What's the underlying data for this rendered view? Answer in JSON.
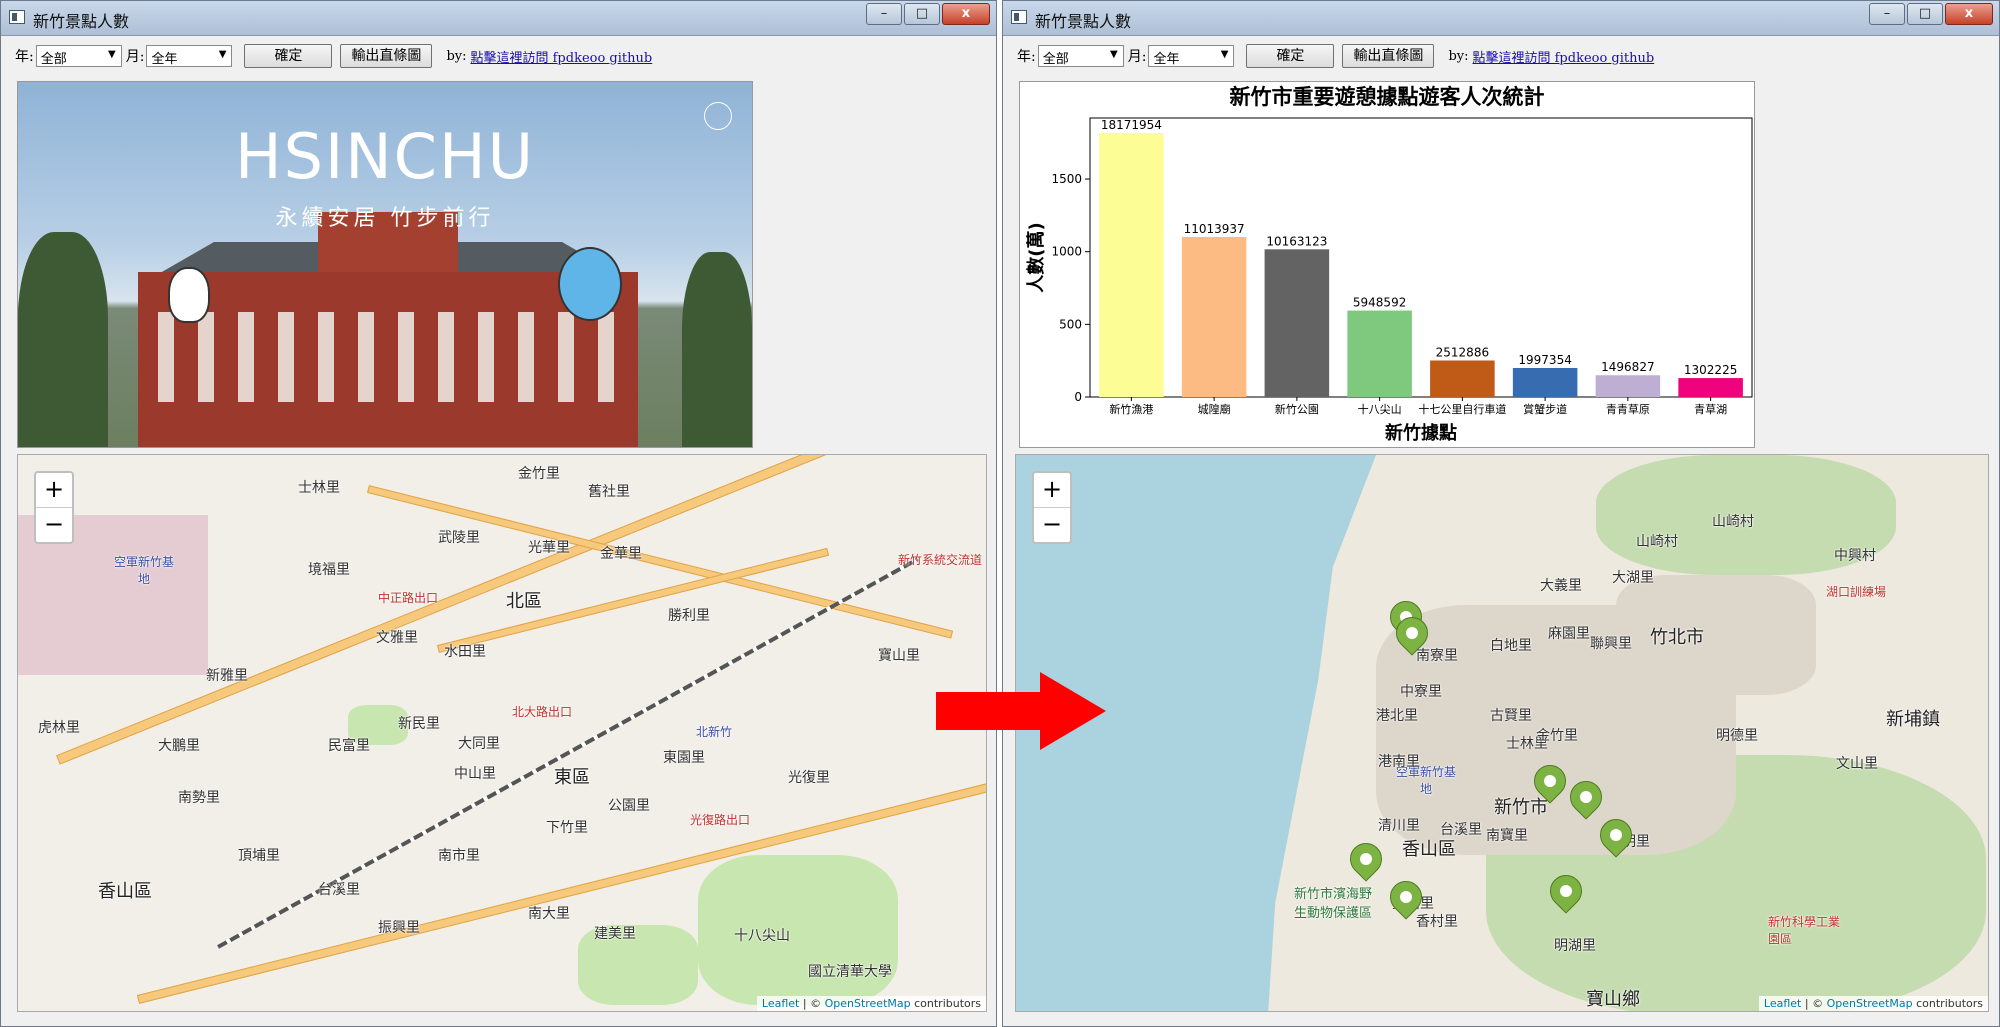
{
  "left": {
    "title": "新竹景點人數",
    "window_buttons": {
      "minimize": "–",
      "maximize": "□",
      "close": "x"
    },
    "toolbar": {
      "year_label": "年:",
      "year_value": "全部",
      "month_label": "月:",
      "month_value": "全年",
      "confirm": "確定",
      "export": "輸出直條圖",
      "by_label": "by:",
      "link_text": "點擊這裡訪問 fpdkeoo github"
    },
    "banner": {
      "title": "HSINCHU",
      "subtitle": "永續安居 竹步前行"
    },
    "map": {
      "zoom_in": "+",
      "zoom_out": "−",
      "attribution": {
        "leaflet": "Leaflet",
        "sep": " | © ",
        "osm": "OpenStreetMap",
        "rest": " contributors"
      },
      "labels": {
        "beiqu": "北區",
        "dongqu": "東區",
        "xiangshan": "香山區",
        "kongjun": "空軍新竹基地",
        "shilin": "士林里",
        "jinzhu": "金竹里",
        "jiushe": "舊社里",
        "jingfu": "境福里",
        "wuling": "武陵里",
        "guanghua": "光華里",
        "jinhua": "金華里",
        "wenya": "文雅里",
        "shuitian": "水田里",
        "xinmin": "新民里",
        "datong": "大同里",
        "minfu": "民富里",
        "zhongshan": "中山里",
        "nanshi": "南市里",
        "dongyuan": "東園里",
        "guangfu": "光復里",
        "xiazhu": "下竹里",
        "gongyuan": "公園里",
        "nanda": "南大里",
        "zhenxing": "振興里",
        "taixi": "台溪里",
        "dingpu": "頂埔里",
        "beixinzhu": "北新竹",
        "xinya": "新雅里",
        "huling": "虎林里",
        "dapeng": "大鵬里",
        "shengli": "勝利里",
        "zhongzheng_exit": "中正路出口",
        "beida_exit": "北大路出口",
        "guangfu_exit": "光復路出口",
        "xinzhu_interchange": "新竹系統交流道",
        "shilan": "十八尖山",
        "qingda": "國立清華大學",
        "nanshizhong": "南勢里",
        "jianmei": "建美里",
        "baosan": "寶山里"
      }
    }
  },
  "right": {
    "title": "新竹景點人數",
    "window_buttons": {
      "minimize": "–",
      "maximize": "□",
      "close": "x"
    },
    "toolbar": {
      "year_label": "年:",
      "year_value": "全部",
      "month_label": "月:",
      "month_value": "全年",
      "confirm": "確定",
      "export": "輸出直條圖",
      "by_label": "by:",
      "link_text": "點擊這裡訪問 fpdkeoo github"
    },
    "map": {
      "zoom_in": "+",
      "zoom_out": "−",
      "attribution": {
        "leaflet": "Leaflet",
        "sep": " | © ",
        "osm": "OpenStreetMap",
        "rest": " contributors"
      },
      "labels": {
        "zhubei": "竹北市",
        "xinfeng": "新埔鎮",
        "baoshan": "寶山鄉",
        "xiangshan": "香山區",
        "xinzhushi": "新竹市",
        "kongjun": "空軍新竹基地",
        "hukou": "湖口訓練場",
        "nanliao": "南寮里",
        "dayi": "大義里",
        "baidi": "白地里",
        "magu": "麻園里",
        "zhonggao": "中寮里",
        "gangbei": "港北里",
        "tulin": "士林里",
        "gangnan": "港南里",
        "qingchuan": "清川里",
        "kejie": "新竹科學工業園區",
        "wenshan": "文山里",
        "shanxi": "山崎村",
        "zhongxing": "中興村",
        "jinzhu": "金竹里",
        "meiqi": "美山里",
        "zhongchuang": "新竹市濱海野生動物保護區",
        "dahu": "大湖里",
        "xiangcun": "香村里",
        "mingtu": "明湖里",
        "guangming": "光明里",
        "nanbo": "南寶里",
        "shanchu": "山崎村",
        "guxin": "古賢里",
        "lianxing": "聯興里",
        "tainan": "台溪里",
        "mingdong": "明德里"
      }
    },
    "chart_data": {
      "type": "bar",
      "title": "新竹市重要遊憩據點遊客人次統計",
      "xlabel": "新竹據點",
      "ylabel": "人數(萬)",
      "ylim": [
        0,
        1920
      ],
      "yticks": [
        0,
        500,
        1000,
        1500
      ],
      "categories": [
        "新竹漁港",
        "城隍廟",
        "新竹公園",
        "十八尖山",
        "十七公里自行車道",
        "賞蟹步道",
        "青青草原",
        "青草湖"
      ],
      "values": [
        18171954,
        11013937,
        10163123,
        5948592,
        2512886,
        1997354,
        1496827,
        1302225
      ],
      "colors": [
        "#fdfd96",
        "#fdbb84",
        "#636363",
        "#7fc97f",
        "#bf5b17",
        "#386cb0",
        "#beaed4",
        "#f0027f"
      ]
    }
  },
  "arrow_color": "#ff0000"
}
